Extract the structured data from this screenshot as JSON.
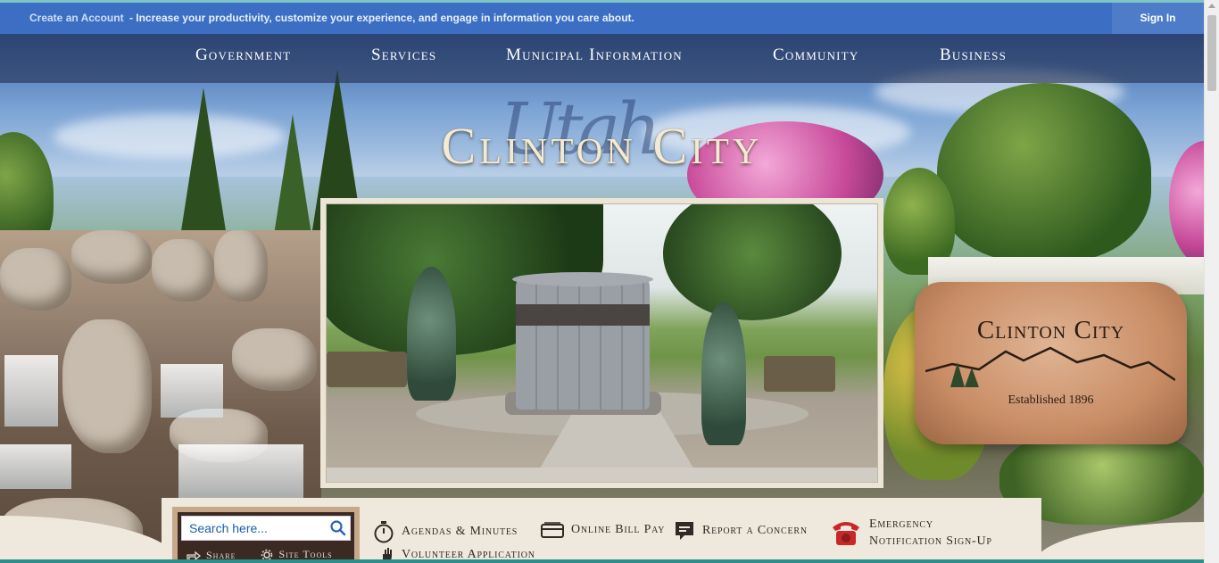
{
  "announcement": {
    "link_text": "Create an Account",
    "message": "- Increase your productivity, customize your experience, and engage in information you care about.",
    "signin_label": "Sign In"
  },
  "nav": {
    "items": [
      {
        "label": "Government"
      },
      {
        "label": "Services"
      },
      {
        "label": "Municipal Information"
      },
      {
        "label": "Community"
      },
      {
        "label": "Business"
      }
    ]
  },
  "hero": {
    "title": "Clinton City",
    "script_text": "Utah",
    "sign_name": "Clinton City",
    "sign_established": "Established 1896"
  },
  "search": {
    "placeholder": "Search here...",
    "share_label": "Share",
    "site_tools_label": "Site Tools"
  },
  "quick_links": [
    {
      "label": "Agendas & Minutes",
      "icon": "stopwatch-icon"
    },
    {
      "label": "Online Bill Pay",
      "icon": "wallet-icon"
    },
    {
      "label": "Report a Concern",
      "icon": "speech-bubble-icon"
    },
    {
      "label_line1": "Emergency",
      "label_line2": "Notification Sign-Up",
      "icon": "telephone-icon"
    },
    {
      "label": "Volunteer Application",
      "icon": "hand-icon"
    }
  ],
  "colors": {
    "announce_bar": "#3c6fc4",
    "nav_overlay": "#233050",
    "quick_links_bg": "#efe9dd",
    "search_text": "#1a5fa8",
    "phone_red": "#c8282a"
  }
}
